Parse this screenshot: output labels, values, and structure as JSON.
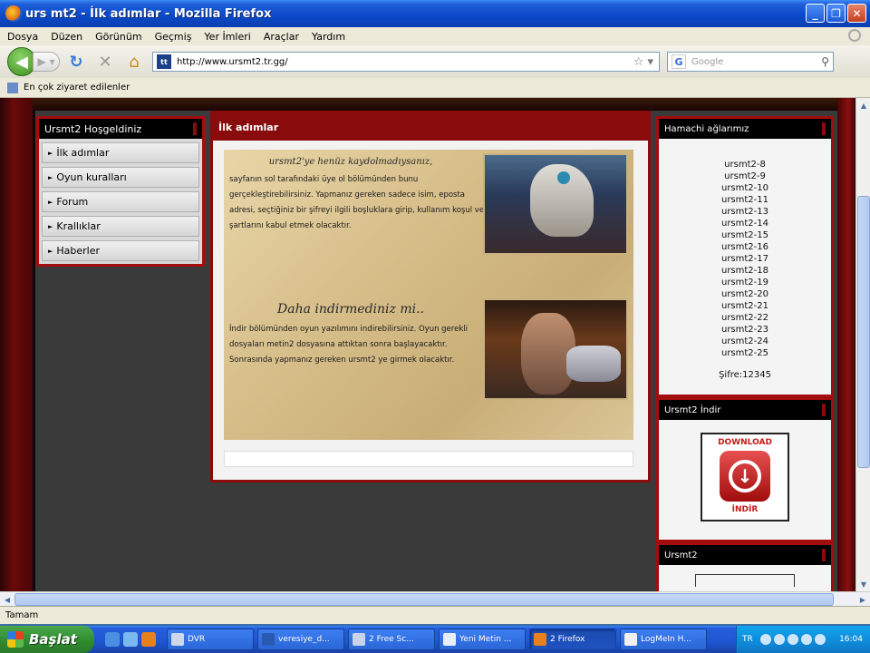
{
  "window": {
    "title": "urs mt2 - İlk adımlar - Mozilla Firefox"
  },
  "menu": [
    "Dosya",
    "Düzen",
    "Görünüm",
    "Geçmiş",
    "Yer İmleri",
    "Araçlar",
    "Yardım"
  ],
  "nav": {
    "url": "http://www.ursmt2.tr.gg/",
    "search_placeholder": "Google",
    "favicon_text": "tt"
  },
  "bookmarks": {
    "label": "En çok ziyaret edilenler"
  },
  "left_menu": {
    "title": "Ursmt2 Hoşgeldiniz",
    "items": [
      "İlk adımlar",
      "Oyun kuralları",
      "Forum",
      "Krallıklar",
      "Haberler"
    ]
  },
  "center": {
    "title": "İlk adımlar",
    "block1_title": "ursmt2'ye henüz kaydolmadıysanız,",
    "block1_text": "sayfanın sol tarafındaki üye ol bölümünden bunu gerçekleştirebilirsiniz. Yapmanız gereken sadece isim, eposta adresi, seçtiğiniz bir şifreyi ilgili boşluklara girip, kullanım koşul ve şartlarını kabul etmek olacaktır.",
    "block2_title": "Daha indirmediniz mi..",
    "block2_text": "İndir bölümünden oyun yazılımını indirebilirsiniz. Oyun gerekli dosyaları metin2 dosyasına attıktan sonra başlayacaktır. Sonrasında yapmanız gereken ursmt2 ye girmek olacaktır."
  },
  "right": {
    "hamachi_title": "Hamachi ağlarımız",
    "hamachi_networks": [
      "ursmt2-8",
      "ursmt2-9",
      "ursmt2-10",
      "ursmt2-11",
      "ursmt2-13",
      "ursmt2-14",
      "ursmt2-15",
      "ursmt2-16",
      "ursmt2-17",
      "ursmt2-18",
      "ursmt2-19",
      "ursmt2-20",
      "ursmt2-21",
      "ursmt2-22",
      "ursmt2-23",
      "ursmt2-24",
      "ursmt2-25"
    ],
    "hamachi_password": "Şifre:12345",
    "download_title": "Ursmt2 İndir",
    "download_top": "DOWNLOAD",
    "download_bottom": "İNDİR",
    "box3_title": "Ursmt2"
  },
  "status": {
    "text": "Tamam"
  },
  "taskbar": {
    "start": "Başlat",
    "tasks": [
      "DVR",
      "veresiye_d...",
      "2 Free Sc...",
      "Yeni Metin ...",
      "2 Firefox",
      "LogMeIn H..."
    ],
    "active_task": 4,
    "lang": "TR",
    "clock": "16:04"
  }
}
